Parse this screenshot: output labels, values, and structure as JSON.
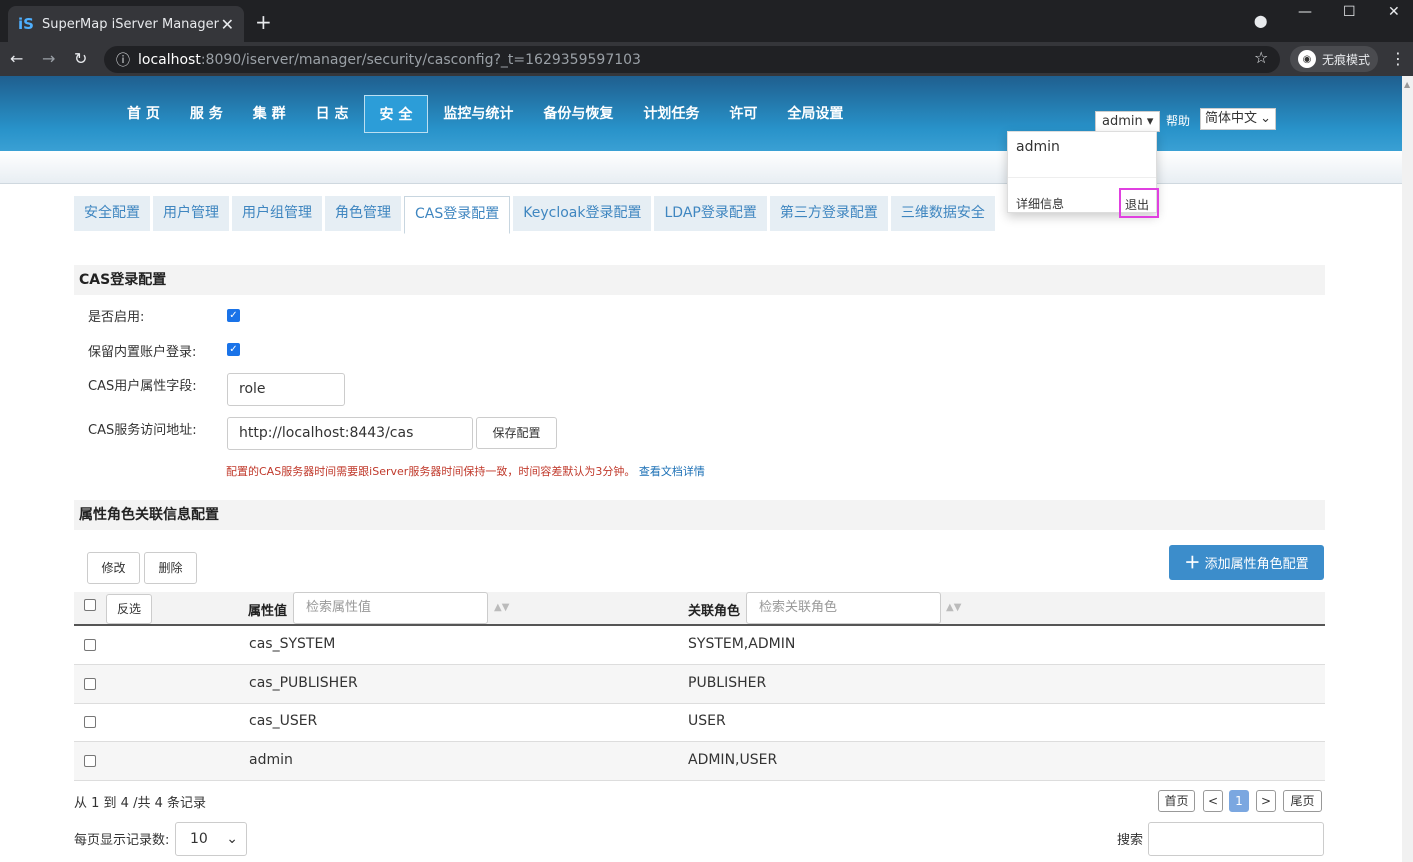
{
  "browser": {
    "tab_favicon": "iS",
    "tab_title": "SuperMap iServer Manager",
    "url_host": "localhost",
    "url_path": ":8090/iserver/manager/security/casconfig?_t=1629359597103",
    "incognito_label": "无痕模式"
  },
  "topnav": [
    "首 页",
    "服 务",
    "集 群",
    "日 志",
    "安 全",
    "监控与统计",
    "备份与恢复",
    "计划任务",
    "许可",
    "全局设置"
  ],
  "header": {
    "user": "admin ▾",
    "help": "帮助",
    "language": "简体中文"
  },
  "user_menu": {
    "name": "admin",
    "details": "详细信息",
    "logout": "退出"
  },
  "subtabs": [
    "安全配置",
    "用户管理",
    "用户组管理",
    "角色管理",
    "CAS登录配置",
    "Keycloak登录配置",
    "LDAP登录配置",
    "第三方登录配置",
    "三维数据安全"
  ],
  "cas": {
    "section_title": "CAS登录配置",
    "enable_label": "是否启用:",
    "keep_builtin_label": "保留内置账户登录:",
    "attr_field_label": "CAS用户属性字段:",
    "attr_field_value": "role",
    "server_url_label": "CAS服务访问地址:",
    "server_url_value": "http://localhost:8443/cas",
    "save_button": "保存配置",
    "warning": "配置的CAS服务器时间需要跟iServer服务器时间保持一致，时间容差默认为3分钟。",
    "doc_link": "查看文档详情"
  },
  "mapping": {
    "section_title": "属性角色关联信息配置",
    "edit_button": "修改",
    "delete_button": "删除",
    "add_button": "添加属性角色配置",
    "invert_button": "反选",
    "col_attr": "属性值",
    "col_attr_placeholder": "检索属性值",
    "col_role": "关联角色",
    "col_role_placeholder": "检索关联角色",
    "rows": [
      {
        "attr": "cas_SYSTEM",
        "role": "SYSTEM,ADMIN"
      },
      {
        "attr": "cas_PUBLISHER",
        "role": "PUBLISHER"
      },
      {
        "attr": "cas_USER",
        "role": "USER"
      },
      {
        "attr": "admin",
        "role": "ADMIN,USER"
      }
    ],
    "info": "从 1 到 4 /共 4 条记录",
    "pager": {
      "first": "首页",
      "prev": "<",
      "current": "1",
      "next": ">",
      "last": "尾页"
    },
    "page_size_label": "每页显示记录数:",
    "page_size": "10",
    "search_label": "搜索"
  }
}
